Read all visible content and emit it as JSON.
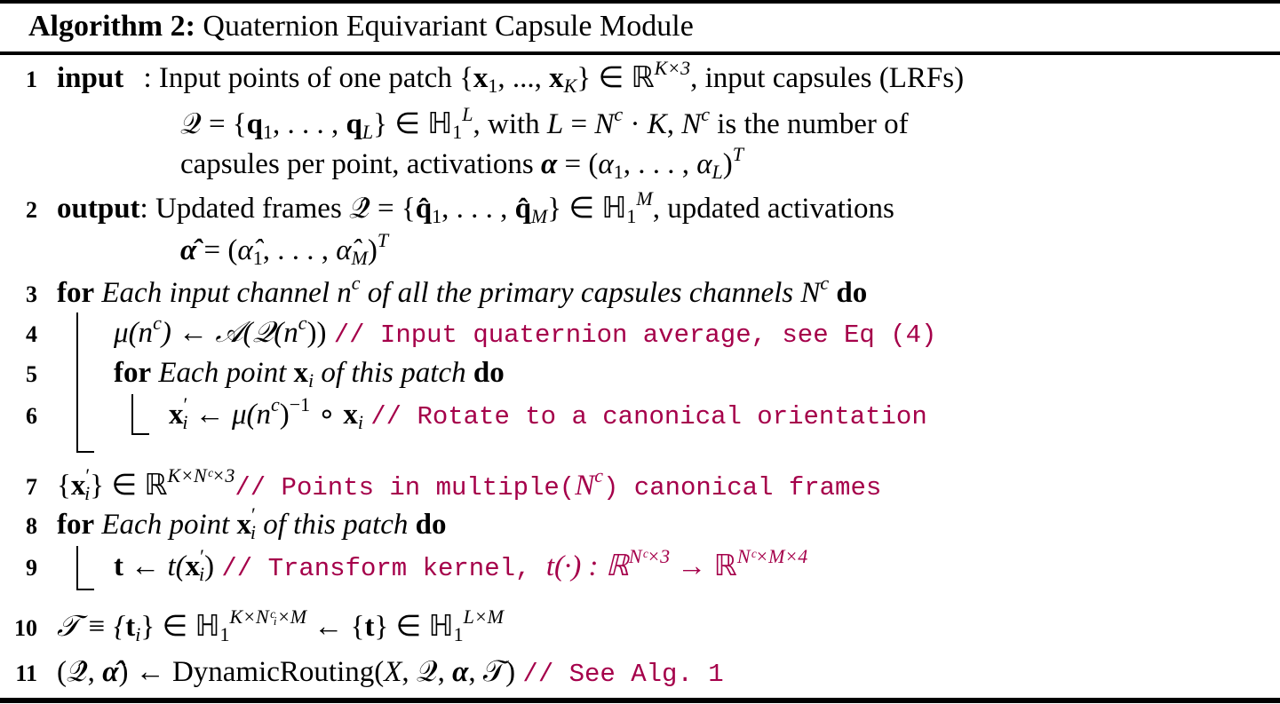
{
  "algorithm": {
    "label": "Algorithm 2:",
    "title": "Quaternion Equivariant Capsule Module"
  },
  "lines": [
    {
      "no": "1",
      "keyword": "input",
      "text_a": ": Input points of one patch {x",
      "text_b": ", ..., x",
      "text_c": "} ∈ ℝ",
      "sup_a": "K×3",
      "text_d": ", input capsules (LRFs)"
    },
    {
      "no": "",
      "text": "𝒬 = {q₁, . . . , q_L} ∈ ℍ₁ᴸ, with L = Nᶜ · K, Nᶜ is the number of"
    },
    {
      "no": "",
      "text": "capsules per point, activations α = (α₁, . . . , α_L)ᵀ"
    },
    {
      "no": "2",
      "keyword": "output",
      "text": ": Updated frames 𝒬̂ = {q̂₁, . . . , q̂_M} ∈ ℍ₁ᴹ, updated activations"
    },
    {
      "no": "",
      "text": "α̂ = (α̂₁, . . . , α̂_M)ᵀ"
    },
    {
      "no": "3",
      "keyword": "for",
      "text": "Each input channel nᶜ of all the primary capsules channels Nᶜ",
      "keyword_end": "do"
    },
    {
      "no": "4",
      "text": "μ(nᶜ) ← 𝒜(𝒬(nᶜ))",
      "comment": "// Input quaternion average, see Eq (4)"
    },
    {
      "no": "5",
      "keyword": "for",
      "text": "Each point xᵢ of this patch",
      "keyword_end": "do"
    },
    {
      "no": "6",
      "text": "x′ᵢ ← μ(nᶜ)⁻¹ ∘ xᵢ",
      "comment": "// Rotate to a canonical orientation"
    },
    {
      "no": "7",
      "text": "{x′ᵢ} ∈ ℝ^(K×Nᶜ×3)",
      "comment": "// Points in multiple(Nᶜ) canonical frames"
    },
    {
      "no": "8",
      "keyword": "for",
      "text": "Each point x′ᵢ of this patch",
      "keyword_end": "do"
    },
    {
      "no": "9",
      "text": "t ← t(x′ᵢ)",
      "comment": "// Transform kernel, t(·) : ℝ^(Nᶜ×3) → ℝ^(Nᶜ×M×4)"
    },
    {
      "no": "10",
      "text": "𝒯 ≡ {tᵢ} ∈ ℍ₁^(K×Nᶜᵢ×M) ← {t} ∈ ℍ₁^(L×M)"
    },
    {
      "no": "11",
      "text": "(𝒬̂, α̂) ← DynamicRouting(X, 𝒬, α, 𝒯)",
      "comment": "// See Alg. 1"
    }
  ],
  "parts": {
    "l1_num": "1",
    "l1_kw": "input",
    "l1_a": ": Input points of one patch {",
    "l1_x": "x",
    "l1_s1": "1",
    "l1_b": ", ..., ",
    "l1_sK": "K",
    "l1_c": "} ∈ ℝ",
    "l1_sup": "K×3",
    "l1_d": ", input capsules (LRFs)",
    "l1b_a": "𝒬 = {",
    "l1b_q": "q",
    "l1b_s1": "1",
    "l1b_b": ", . . . , ",
    "l1b_sL": "L",
    "l1b_c": "} ∈ ℍ",
    "l1b_h1": "1",
    "l1b_supL": "L",
    "l1b_d": ", with ",
    "l1b_L": "L",
    "l1b_e": " = ",
    "l1b_N": "N",
    "l1b_c1": "c",
    "l1b_f": " · ",
    "l1b_K": "K",
    "l1b_g": ", ",
    "l1b_N2": "N",
    "l1b_c2": "c",
    "l1b_h": " is the number of",
    "l1c_a": "capsules per point, activations ",
    "l1c_alpha": "α",
    "l1c_b": " = (",
    "l1c_a1": "α",
    "l1c_s1": "1",
    "l1c_c": ", . . . , ",
    "l1c_aL": "α",
    "l1c_sL": "L",
    "l1c_d": ")",
    "l1c_T": "T",
    "l2_num": "2",
    "l2_kw": "output",
    "l2_a": ": Updated frames ",
    "l2_Q": "𝒬̂",
    "l2_b": " = {",
    "l2_q": "q̂",
    "l2_s1": "1",
    "l2_c": ", . . . , ",
    "l2_sM": "M",
    "l2_d": "} ∈ ℍ",
    "l2_h1": "1",
    "l2_supM": "M",
    "l2_e": ", updated activations",
    "l2b_alpha": "α̂",
    "l2b_a": " = (",
    "l2b_a1": "α̂",
    "l2b_s1": "1",
    "l2b_b": ", . . . , ",
    "l2b_aM": "α̂",
    "l2b_sM": "M",
    "l2b_c": ")",
    "l2b_T": "T",
    "l3_num": "3",
    "l3_kw": "for",
    "l3_a": "Each input channel ",
    "l3_n": "n",
    "l3_c": "c",
    "l3_b": " of all the primary capsules channels ",
    "l3_N": "N",
    "l3_c2": "c",
    "l3_do": "do",
    "l4_num": "4",
    "l4_a": "μ(n",
    "l4_c": "c",
    "l4_b": ") ← 𝒜(𝒬(n",
    "l4_c2": "c",
    "l4_d": "))",
    "l4_cm": "// Input quaternion average, see Eq (4)",
    "l5_num": "5",
    "l5_kw": "for",
    "l5_a": "Each point ",
    "l5_x": "x",
    "l5_i": "i",
    "l5_b": " of this patch",
    "l5_do": "do",
    "l6_num": "6",
    "l6_x": "x",
    "l6_p": "′",
    "l6_i": "i",
    "l6_a": " ← μ(n",
    "l6_c": "c",
    "l6_b": ")",
    "l6_inv": "−1",
    "l6_d": " ∘ ",
    "l6_x2": "x",
    "l6_i2": "i",
    "l6_cm": "// Rotate to a canonical orientation",
    "l7_num": "7",
    "l7_a": "{",
    "l7_x": "x",
    "l7_p": "′",
    "l7_i": "i",
    "l7_b": "} ∈ ℝ",
    "l7_sup": "K×Nᶜ×3",
    "l7_cm1": "// Points in multiple(",
    "l7_cmN": "N",
    "l7_cmc": "c",
    "l7_cm2": ") canonical frames",
    "l8_num": "8",
    "l8_kw": "for",
    "l8_a": "Each point ",
    "l8_x": "x",
    "l8_p": "′",
    "l8_i": "i",
    "l8_b": " of this patch",
    "l8_do": "do",
    "l9_num": "9",
    "l9_t": "t",
    "l9_a": " ← t(",
    "l9_x": "x",
    "l9_p": "′",
    "l9_i": "i",
    "l9_b": ")",
    "l9_cm": "// Transform kernel, ",
    "l9_m1": "t(·) : ℝ",
    "l9_sup1": "Nᶜ×3",
    "l9_m2": " → ℝ",
    "l9_sup2": "Nᶜ×M×4",
    "l10_num": "10",
    "l10_a": "𝒯 ≡ {",
    "l10_t": "t",
    "l10_i": "i",
    "l10_b": "} ∈ ℍ",
    "l10_h1": "1",
    "l10_sup1": "K×Nᶜᵢ×M",
    "l10_c": " ← {",
    "l10_t2": "t",
    "l10_d": "} ∈ ℍ",
    "l10_h2": "1",
    "l10_sup2": "L×M",
    "l11_num": "11",
    "l11_a": "(𝒬̂, ",
    "l11_al": "α̂",
    "l11_b": ") ← DynamicRouting(",
    "l11_X": "X",
    "l11_c": ", 𝒬, ",
    "l11_al2": "α",
    "l11_d": ", 𝒯)",
    "l11_cm": "// See Alg. 1"
  },
  "colors": {
    "comment": "#a5004a",
    "text": "#000000",
    "background": "#ffffff"
  }
}
